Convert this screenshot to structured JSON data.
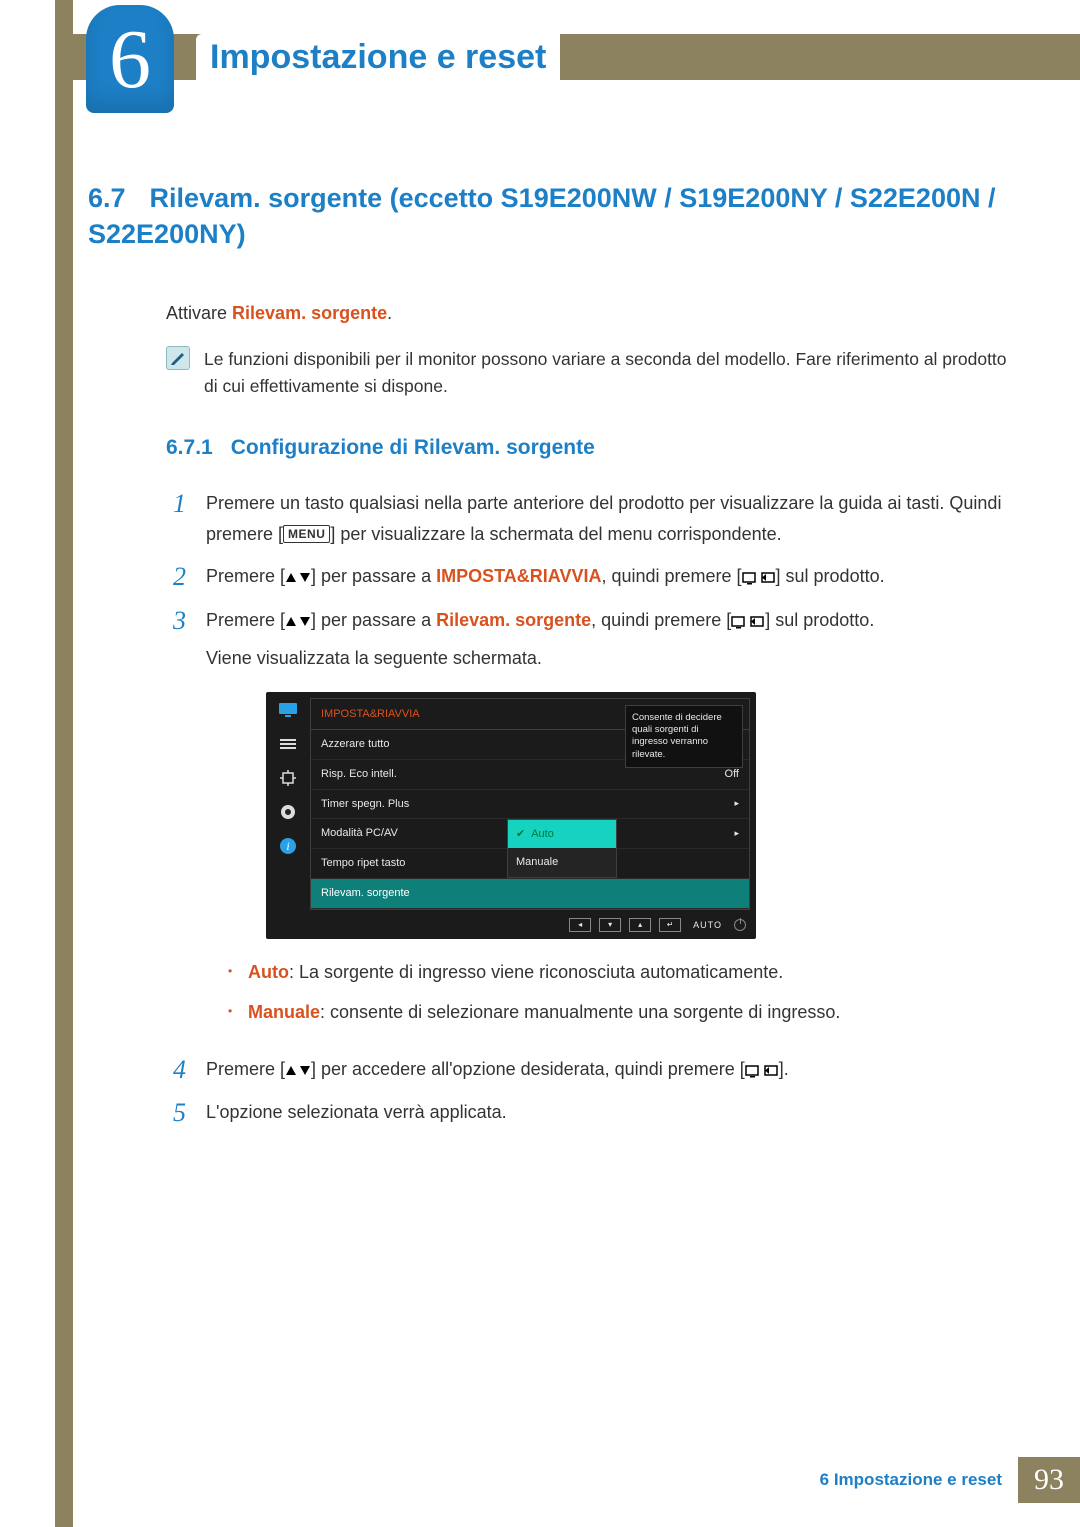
{
  "chapter": {
    "number": "6",
    "title": "Impostazione e reset"
  },
  "section": {
    "number": "6.7",
    "title": "Rilevam. sorgente (eccetto S19E200NW / S19E200NY / S22E200N / S22E200NY)"
  },
  "intro": {
    "pre": "Attivare ",
    "term": "Rilevam. sorgente",
    "post": "."
  },
  "note": "Le funzioni disponibili per il monitor possono variare a seconda del modello. Fare riferimento al prodotto di cui effettivamente si dispone.",
  "subsection": {
    "number": "6.7.1",
    "title": "Configurazione di Rilevam. sorgente"
  },
  "steps": {
    "s1a": "Premere un tasto qualsiasi nella parte anteriore del prodotto per visualizzare la guida ai tasti. Quindi premere [",
    "s1b": "] per visualizzare la schermata del menu corrispondente.",
    "s2a": "Premere [",
    "s2b": "] per passare a ",
    "s2c": "IMPOSTA&RIAVVIA",
    "s2d": ", quindi premere [",
    "s2e": "] sul prodotto.",
    "s3a": "Premere [",
    "s3b": "] per passare a ",
    "s3c": "Rilevam. sorgente",
    "s3d": ", quindi premere [",
    "s3e": "] sul prodotto.",
    "s3f": "Viene visualizzata la seguente schermata.",
    "s4a": "Premere [",
    "s4b": "] per accedere all'opzione desiderata, quindi premere [",
    "s4c": "].",
    "s5": "L'opzione selezionata verrà applicata."
  },
  "kbd": {
    "menu": "MENU"
  },
  "bullets": {
    "auto_t": "Auto",
    "auto_d": ": La sorgente di ingresso viene riconosciuta automaticamente.",
    "man_t": "Manuale",
    "man_d": ": consente di selezionare manualmente una sorgente di ingresso."
  },
  "osd": {
    "title": "IMPOSTA&RIAVVIA",
    "rows": [
      {
        "label": "Azzerare tutto",
        "value": ""
      },
      {
        "label": "Risp. Eco intell.",
        "value": "Off"
      },
      {
        "label": "Timer spegn. Plus",
        "value": "▸"
      },
      {
        "label": "Modalità PC/AV",
        "value": "▸"
      },
      {
        "label": "Tempo ripet tasto",
        "value": ""
      },
      {
        "label": "Rilevam. sorgente",
        "value": ""
      }
    ],
    "popover": {
      "selected": "Auto",
      "other": "Manuale"
    },
    "tooltip": "Consente di decidere quali sorgenti di ingresso verranno rilevate.",
    "bar_auto": "AUTO"
  },
  "footer": {
    "text": "6 Impostazione e reset",
    "page": "93"
  }
}
